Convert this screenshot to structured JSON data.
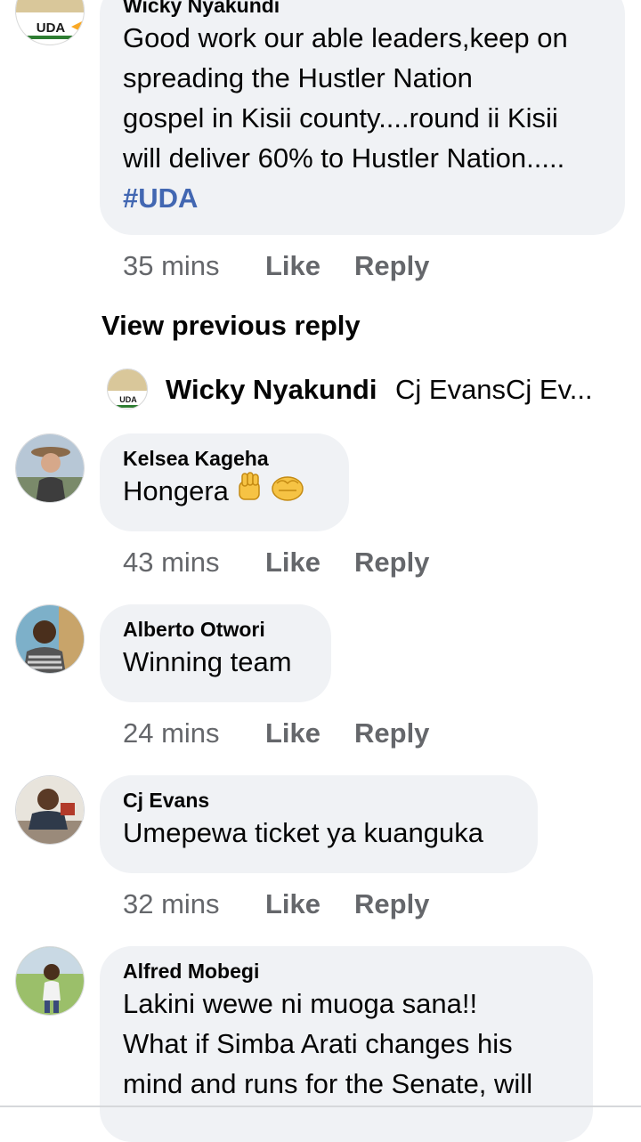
{
  "comments": [
    {
      "name": "Wicky Nyakundi",
      "lines": [
        "Good work our able leaders,keep on",
        "spreading the Hustler Nation",
        "gospel in Kisii county....round ii Kisii",
        "will deliver 60% to Hustler Nation....."
      ],
      "hashtag": "#UDA",
      "time": "35 mins",
      "like": "Like",
      "reply": "Reply"
    },
    {
      "name": "Kelsea Kageha",
      "text": "Hongera",
      "time": "43 mins",
      "like": "Like",
      "reply": "Reply"
    },
    {
      "name": "Alberto Otwori",
      "text": "Winning team",
      "time": "24 mins",
      "like": "Like",
      "reply": "Reply"
    },
    {
      "name": "Cj Evans",
      "text": "Umepewa ticket ya kuanguka",
      "time": "32 mins",
      "like": "Like",
      "reply": "Reply"
    },
    {
      "name": "Alfred Mobegi",
      "lines": [
        "Lakini wewe ni muoga sana!!",
        "What if Simba Arati changes his",
        "mind and runs for the Senate, will"
      ]
    }
  ],
  "view_previous": "View previous reply",
  "reply_preview": {
    "name": "Wicky Nyakundi",
    "text": "Cj EvansCj Ev..."
  },
  "avatar_badge": "UDA",
  "emojis": [
    "raised-fist-icon",
    "oncoming-fist-icon"
  ],
  "colors": {
    "bubble": "#f0f2f5",
    "meta": "#65676b",
    "hashtag": "#4267b2"
  }
}
